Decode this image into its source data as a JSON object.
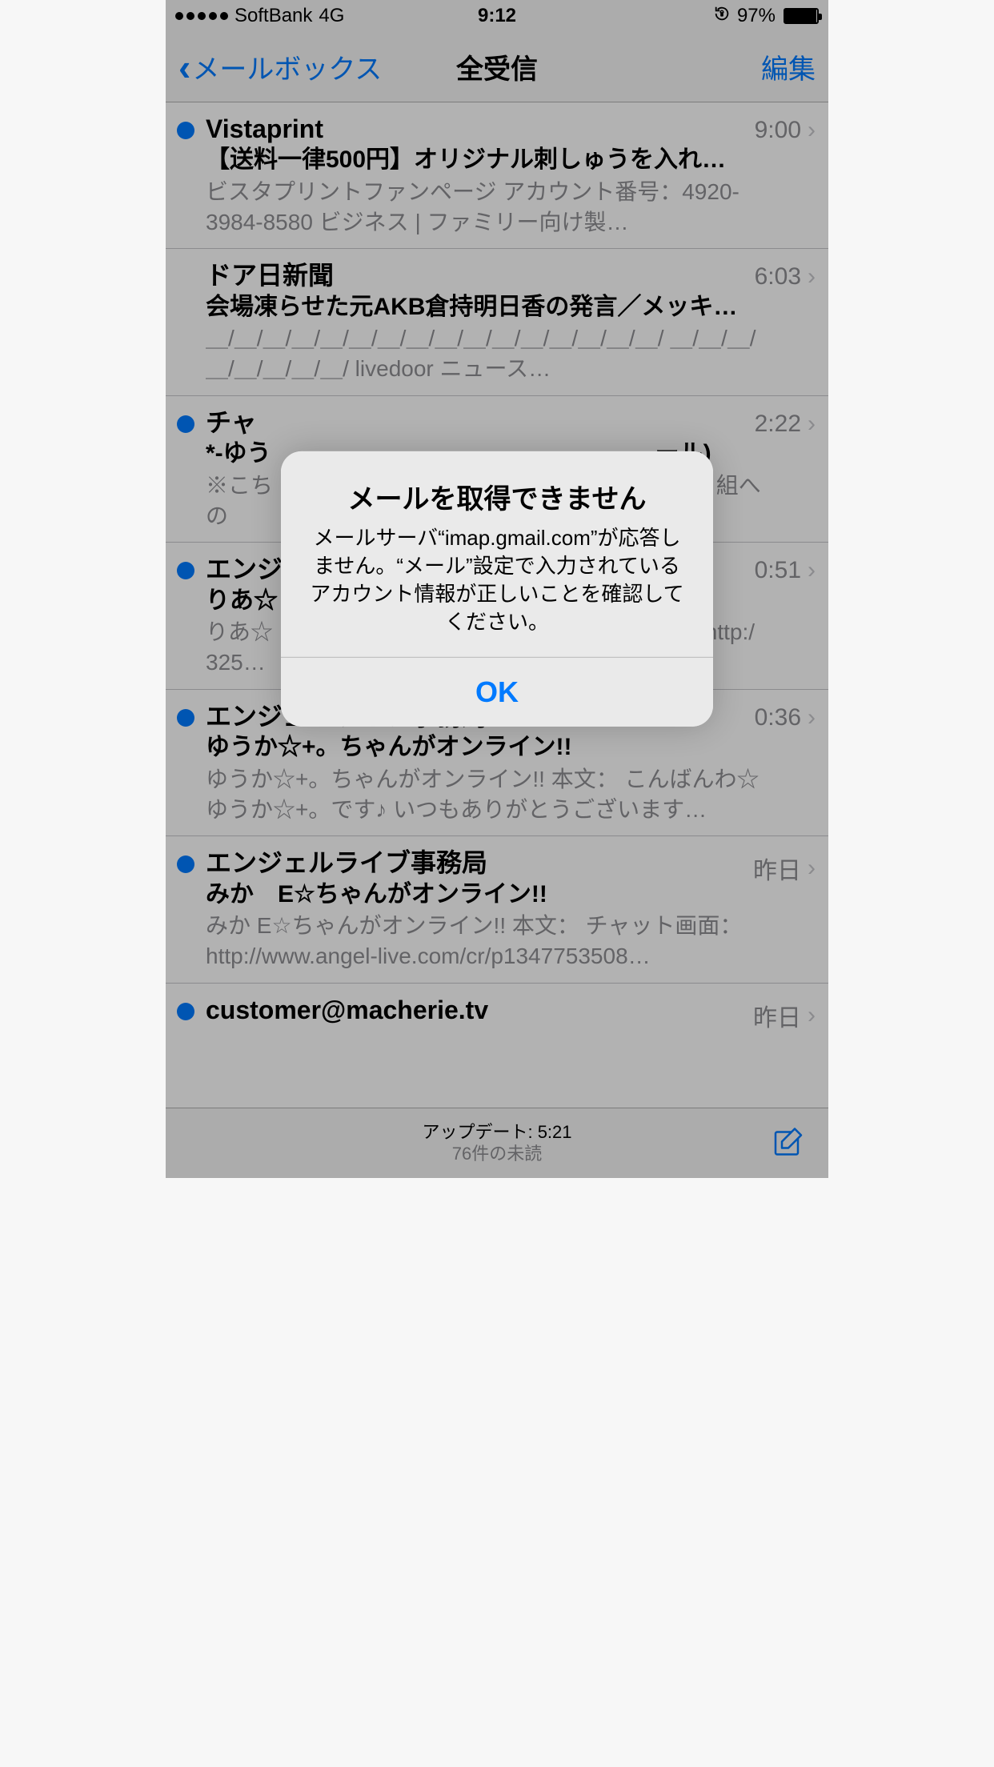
{
  "statusbar": {
    "carrier": "SoftBank",
    "network": "4G",
    "time": "9:12",
    "orientation_lock_icon": "⊕",
    "battery_percent": "97%"
  },
  "navbar": {
    "back_label": "メールボックス",
    "title": "全受信",
    "edit_label": "編集"
  },
  "messages": [
    {
      "unread": true,
      "sender": "Vistaprint",
      "time": "9:00",
      "subject": "【送料一律500円】オリジナル刺しゅうを入れ…",
      "preview": "ビスタプリントファンページ アカウント番号：4920-3984-8580 ビジネス | ファミリー向け製…"
    },
    {
      "unread": false,
      "sender": "ドア日新聞",
      "time": "6:03",
      "subject": "会場凍らせた元AKB倉持明日香の発言／メッキ…",
      "preview": "＿/＿/＿/＿/＿/＿/＿/＿/＿/＿/＿/＿/＿/＿/＿/＿/ ＿/＿/＿/＿/＿/＿/＿/＿/ livedoor ニュース…"
    },
    {
      "unread": true,
      "sender": "チャ",
      "time": "2:22",
      "subject": "*-ゆう　　　　　　　　　　　　　　　　ール)",
      "preview": "※こち　　　　　　　　　　　　　　　　　。　番 組への　　　　　　　　　　　　　　　　い。…"
    },
    {
      "unread": true,
      "sender": "エンジ",
      "time": "0:51",
      "subject": "りあ☆",
      "preview": "りあ☆　　　　　　　　　　　　　　　　　面： http:/　　　　　　　　　　　　　　　　325…"
    },
    {
      "unread": true,
      "sender": "エンジェルライブ事務局",
      "time": "0:36",
      "subject": "ゆうか☆+。ちゃんがオンライン!!",
      "preview": "ゆうか☆+。ちゃんがオンライン!! 本文： こんばんわ☆ ゆうか☆+。です♪ いつもありがとうございます…"
    },
    {
      "unread": true,
      "sender": "エンジェルライブ事務局",
      "time": "昨日",
      "subject": "みか　E☆ちゃんがオンライン!!",
      "preview": "みか E☆ちゃんがオンライン!! 本文： チャット画面：http://www.angel-live.com/cr/p1347753508…"
    },
    {
      "unread": true,
      "sender": "customer@macherie.tv",
      "time": "昨日",
      "subject": "",
      "preview": ""
    }
  ],
  "toolbar": {
    "update_label": "アップデート: 5:21",
    "unread_label": "76件の未読"
  },
  "alert": {
    "title": "メールを取得できません",
    "message": "メールサーバ“imap.gmail.com”が応答しません。“メール”設定で入力されているアカウント情報が正しいことを確認してください。",
    "ok": "OK"
  }
}
